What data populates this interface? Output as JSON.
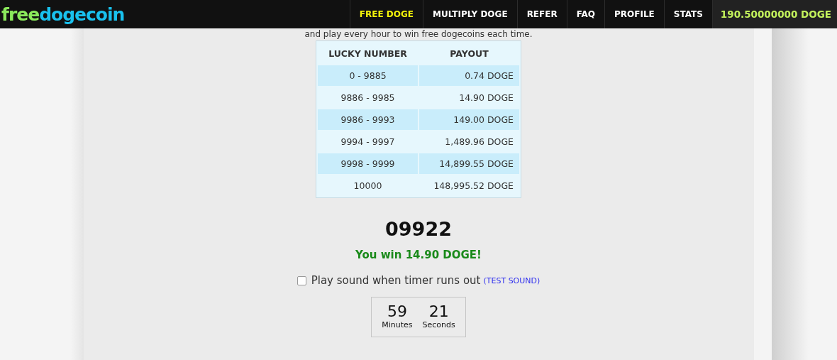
{
  "logo": {
    "part_1": "free",
    "part_2": "dogecoin"
  },
  "nav": [
    {
      "label": "FREE DOGE",
      "selected": true
    },
    {
      "label": "MULTIPLY DOGE",
      "selected": false
    },
    {
      "label": "REFER",
      "selected": false
    },
    {
      "label": "FAQ",
      "selected": false
    },
    {
      "label": "PROFILE",
      "selected": false
    },
    {
      "label": "STATS",
      "selected": false
    }
  ],
  "balance": "190.50000000 DOGE",
  "intro": "and play every hour to win free dogecoins each time.",
  "table": {
    "columns": [
      "LUCKY NUMBER",
      "PAYOUT"
    ],
    "rows": [
      [
        "0 - 9885",
        "0.74 DOGE"
      ],
      [
        "9886 - 9985",
        "14.90 DOGE"
      ],
      [
        "9986 - 9993",
        "149.00 DOGE"
      ],
      [
        "9994 - 9997",
        "1,489.96 DOGE"
      ],
      [
        "9998 - 9999",
        "14,899.55 DOGE"
      ],
      [
        "10000",
        "148,995.52 DOGE"
      ]
    ]
  },
  "roll": "09922",
  "result": "You win 14.90 DOGE!",
  "sound": {
    "label": "Play sound when timer runs out",
    "checked": false,
    "link": "(TEST SOUND)"
  },
  "timer": [
    {
      "value": "59",
      "unit": "Minutes"
    },
    {
      "value": "21",
      "unit": "Seconds"
    }
  ]
}
